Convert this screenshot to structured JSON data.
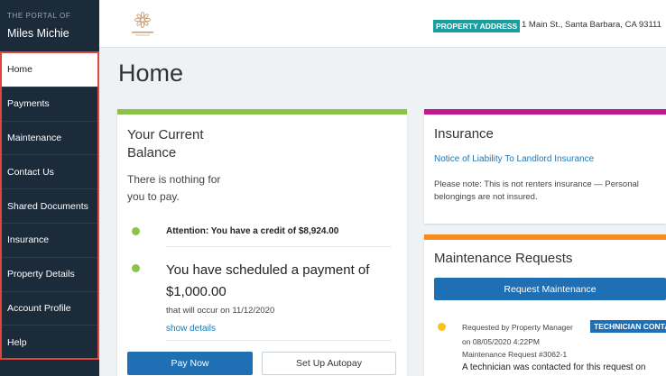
{
  "sidebar": {
    "portal_label": "THE PORTAL OF",
    "user_name": "Miles Michie",
    "items": [
      {
        "label": "Home"
      },
      {
        "label": "Payments"
      },
      {
        "label": "Maintenance"
      },
      {
        "label": "Contact Us"
      },
      {
        "label": "Shared Documents"
      },
      {
        "label": "Insurance"
      },
      {
        "label": "Property Details"
      },
      {
        "label": "Account Profile"
      },
      {
        "label": "Help"
      }
    ]
  },
  "header": {
    "address_badge": "PROPERTY ADDRESS",
    "address": "1 Main St., Santa Barbara, CA 93111"
  },
  "page": {
    "title": "Home"
  },
  "balance": {
    "title_line1": "Your Current",
    "title_line2": "Balance",
    "message_line1": "There is nothing for",
    "message_line2": "you to pay.",
    "attention": "Attention: You have a credit of $8,924.00",
    "scheduled_line1": "You have scheduled a payment of",
    "scheduled_amount": "$1,000.00",
    "occur": "that will occur on 11/12/2020",
    "show_details": "show details",
    "pay_now": "Pay Now",
    "autopay": "Set Up Autopay"
  },
  "insurance": {
    "title": "Insurance",
    "link": "Notice of Liability To Landlord Insurance",
    "note_line1": "Please note: This is not renters insurance — Personal",
    "note_line2": "belongings are not insured."
  },
  "maintenance": {
    "title": "Maintenance Requests",
    "button": "Request Maintenance",
    "requested_by": "Requested by Property Manager",
    "badge": "TECHNICIAN CONTACTED",
    "date": "on 08/05/2020 4:22PM",
    "request_no": "Maintenance Request #3062-1",
    "detail": "A technician was contacted for this request on"
  },
  "colors": {
    "sidebar": "#1c2b3a",
    "highlight_border": "#e0453a",
    "primary": "#1f6fb5",
    "balance_accent": "#8bc34a",
    "insurance_accent": "#c2188f",
    "maintenance_accent": "#f58c1f",
    "address_badge": "#18a0a0",
    "pending_dot": "#f5c518"
  }
}
